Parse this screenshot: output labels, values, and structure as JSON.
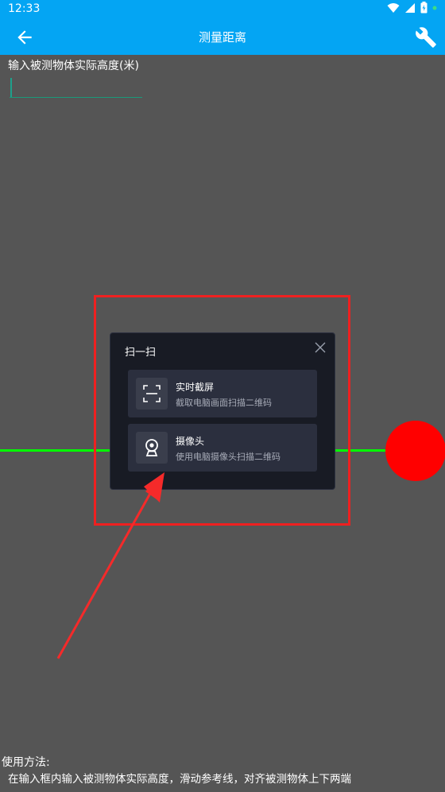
{
  "status_bar": {
    "time": "12:33"
  },
  "app_bar": {
    "title": "测量距离"
  },
  "height_input": {
    "label": "输入被测物体实际高度(米)",
    "value": "",
    "placeholder": ""
  },
  "dialog": {
    "title": "扫一扫",
    "options": [
      {
        "title": "实时截屏",
        "description": "截取电脑画面扫描二维码",
        "icon": "scan-frame-icon"
      },
      {
        "title": "摄像头",
        "description": "使用电脑摄像头扫描二维码",
        "icon": "webcam-icon"
      }
    ]
  },
  "usage": {
    "title": "使用方法:",
    "text": "在输入框内输入被测物体实际高度，滑动参考线，对齐被测物体上下两端"
  },
  "colors": {
    "app_bar": "#04a5f3",
    "background": "#555555",
    "reference_line": "#00ff00",
    "marker": "#ff0000",
    "highlight": "#ef2020",
    "dialog_bg": "#181b24"
  }
}
